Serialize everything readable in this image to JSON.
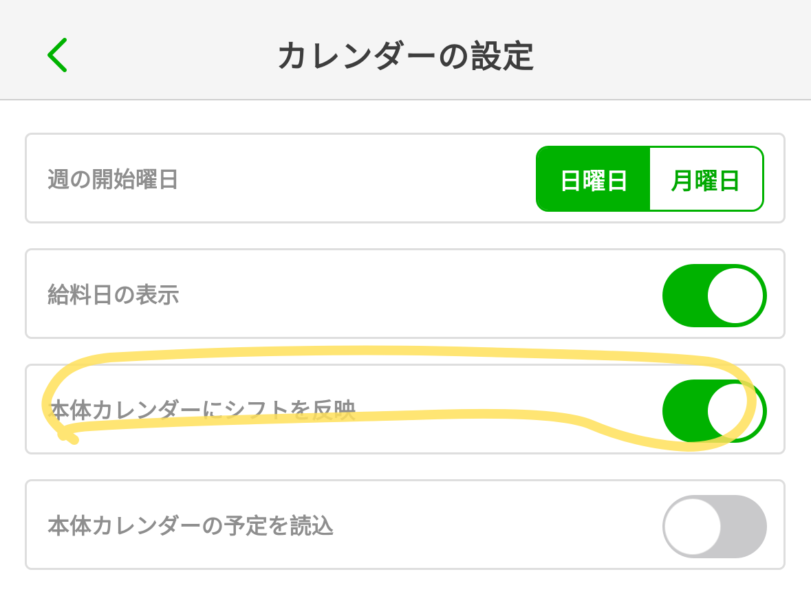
{
  "header": {
    "title": "カレンダーの設定",
    "accent_color": "#00b200"
  },
  "settings": {
    "week_start": {
      "label": "週の開始曜日",
      "options": [
        "日曜日",
        "月曜日"
      ],
      "selected": "日曜日"
    },
    "payday": {
      "label": "給料日の表示",
      "on": true
    },
    "reflect_shift": {
      "label": "本体カレンダーにシフトを反映",
      "on": true
    },
    "import_events": {
      "label": "本体カレンダーの予定を読込",
      "on": false
    }
  },
  "annotation": {
    "highlight_color": "#ffe15a"
  }
}
